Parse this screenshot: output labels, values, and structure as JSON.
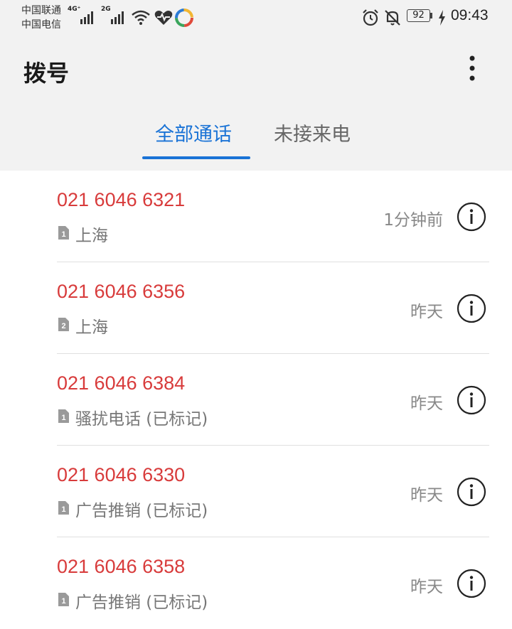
{
  "status_bar": {
    "carrier1": "中国联通",
    "carrier2": "中国电信",
    "net1": "4G⁺",
    "net2": "2G",
    "battery": "92",
    "time": "09:43"
  },
  "header": {
    "title": "拨号"
  },
  "tabs": [
    {
      "label": "全部通话",
      "active": true
    },
    {
      "label": "未接来电",
      "active": false
    }
  ],
  "calls": [
    {
      "number": "021 6046 6321",
      "sim": "1",
      "location": "上海",
      "time": "1分钟前",
      "missed": true
    },
    {
      "number": "021 6046 6356",
      "sim": "2",
      "location": "上海",
      "time": "昨天",
      "missed": true
    },
    {
      "number": "021 6046 6384",
      "sim": "1",
      "location": "骚扰电话 (已标记)",
      "time": "昨天",
      "missed": true
    },
    {
      "number": "021 6046 6330",
      "sim": "1",
      "location": "广告推销 (已标记)",
      "time": "昨天",
      "missed": true
    },
    {
      "number": "021 6046 6358",
      "sim": "1",
      "location": "广告推销 (已标记)",
      "time": "昨天",
      "missed": true
    }
  ],
  "colors": {
    "accent": "#1a73d6",
    "missed": "#d83b3b",
    "header_bg": "#f2f2f2"
  }
}
